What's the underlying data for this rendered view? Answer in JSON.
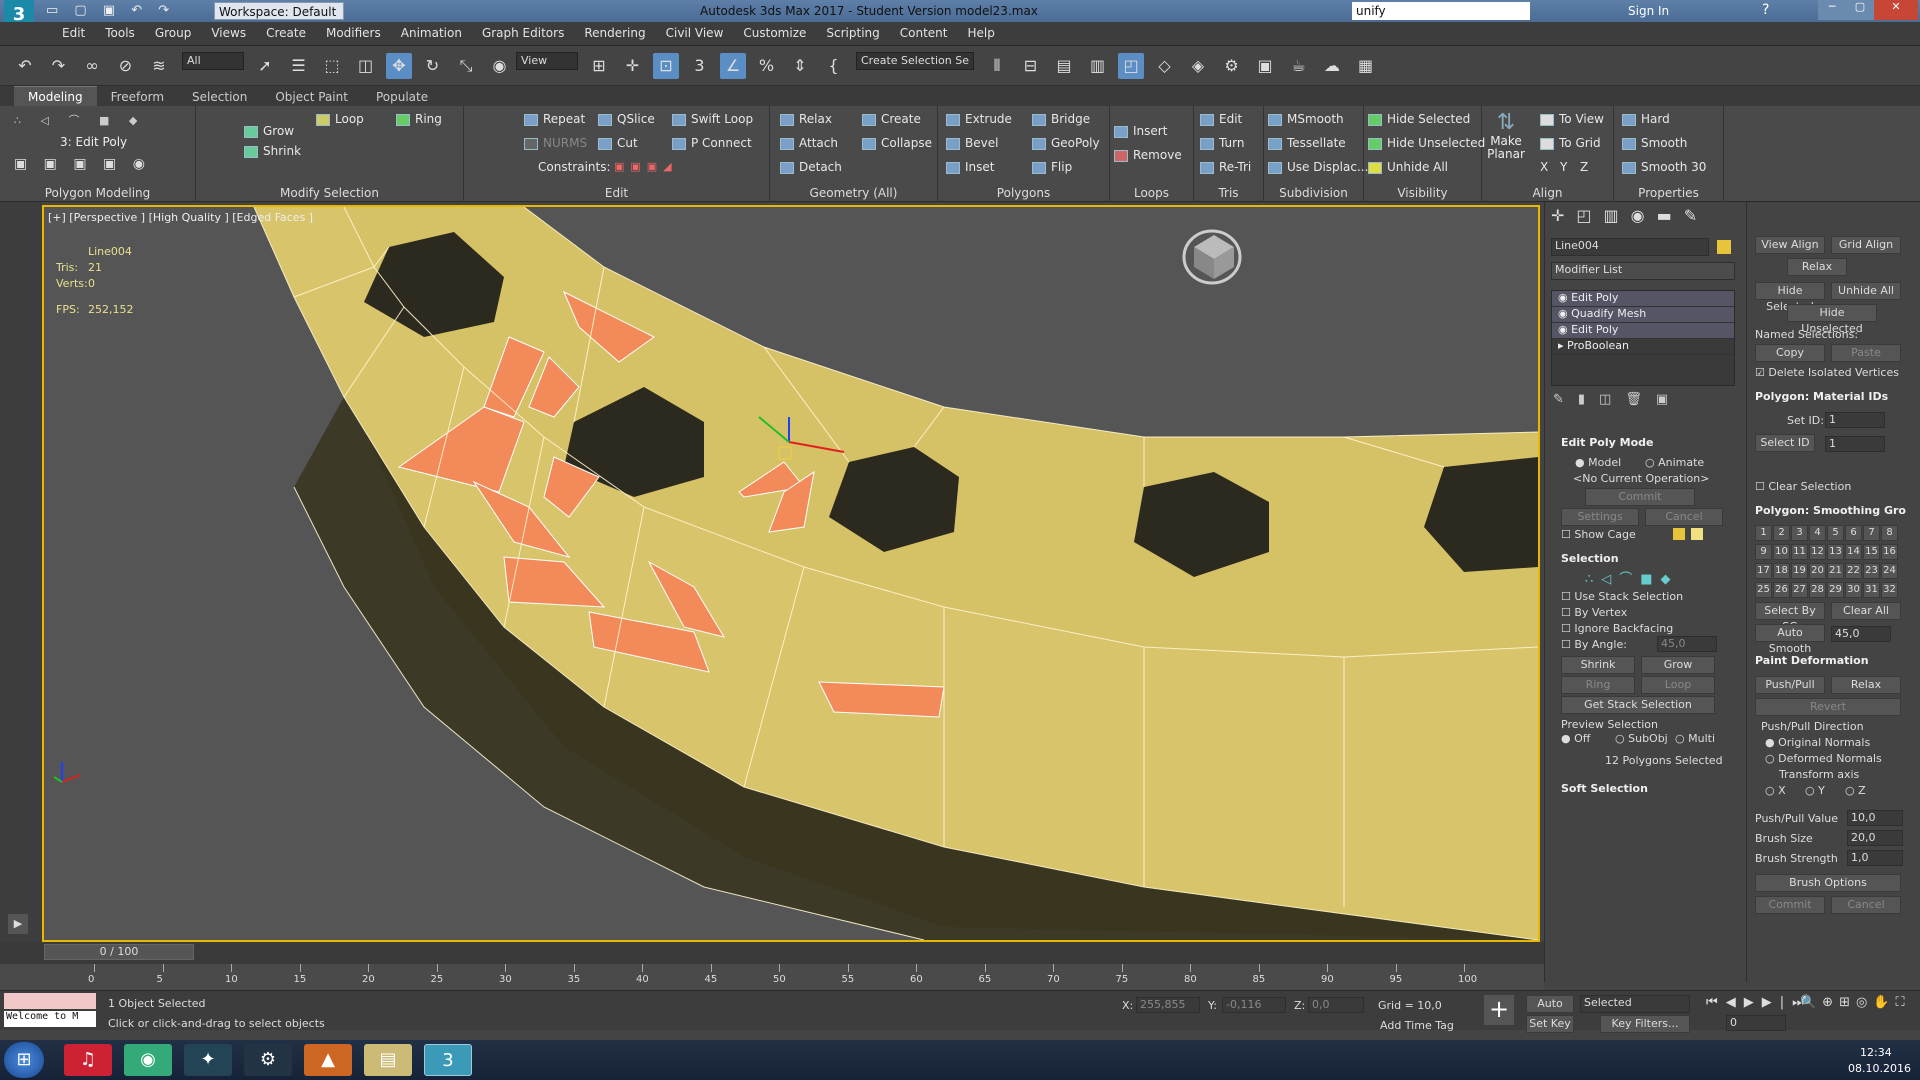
{
  "titlebar": {
    "app_icon": "3",
    "workspace": "Workspace: Default",
    "title": "Autodesk 3ds Max 2017 - Student Version    model23.max",
    "search_value": "unify",
    "sign_in": "Sign In"
  },
  "menu": [
    "Edit",
    "Tools",
    "Group",
    "Views",
    "Create",
    "Modifiers",
    "Animation",
    "Graph Editors",
    "Rendering",
    "Civil View",
    "Customize",
    "Scripting",
    "Content",
    "Help"
  ],
  "toolbar": {
    "filter": "All",
    "view": "View",
    "selection_set": "Create Selection Se"
  },
  "ribbon_tabs": [
    "Modeling",
    "Freeform",
    "Selection",
    "Object Paint",
    "Populate"
  ],
  "ribbon": {
    "polygon_modeling": {
      "label": "Polygon Modeling",
      "stack": "3: Edit Poly"
    },
    "modify_selection": {
      "label": "Modify Selection",
      "grow": "Grow",
      "shrink": "Shrink",
      "loop": "Loop",
      "ring": "Ring"
    },
    "edit": {
      "label": "Edit",
      "repeat": "Repeat",
      "qslice": "QSlice",
      "swift_loop": "Swift Loop",
      "nurms": "NURMS",
      "cut": "Cut",
      "p_connect": "P Connect",
      "constraints": "Constraints:"
    },
    "geometry": {
      "label": "Geometry (All)",
      "relax": "Relax",
      "create": "Create",
      "attach": "Attach",
      "collapse": "Collapse",
      "detach": "Detach"
    },
    "polygons": {
      "label": "Polygons",
      "extrude": "Extrude",
      "bridge": "Bridge",
      "bevel": "Bevel",
      "geopoly": "GeoPoly",
      "inset": "Inset",
      "flip": "Flip"
    },
    "loops": {
      "label": "Loops",
      "insert": "Insert",
      "remove": "Remove"
    },
    "tris": {
      "label": "Tris",
      "edit": "Edit",
      "turn": "Turn",
      "re_tri": "Re-Tri"
    },
    "subdivision": {
      "label": "Subdivision",
      "msmooth": "MSmooth",
      "tessellate": "Tessellate",
      "use_displac": "Use Displac..."
    },
    "visibility": {
      "label": "Visibility",
      "hide_selected": "Hide Selected",
      "hide_unselected": "Hide Unselected",
      "unhide_all": "Unhide All"
    },
    "align": {
      "label": "Align",
      "make_planar": "Make Planar",
      "to_view": "To View",
      "to_grid": "To Grid",
      "x": "X",
      "y": "Y",
      "z": "Z"
    },
    "properties": {
      "label": "Properties",
      "hard": "Hard",
      "smooth": "Smooth",
      "smooth30": "Smooth 30"
    }
  },
  "viewport": {
    "label": "[+] [Perspective ] [High Quality ] [Edged Faces ]",
    "stats_name": "Line004",
    "tris_label": "Tris:",
    "tris": "21",
    "verts_label": "Verts:",
    "verts": "0",
    "fps_label": "FPS:",
    "fps": "252,152",
    "base_color": "#d8c46a",
    "selected_color": "#f28a5a"
  },
  "cmdpanel": {
    "object_name": "Line004",
    "modifier_list": "Modifier List",
    "stack": [
      "Edit Poly",
      "Quadify Mesh",
      "Edit Poly",
      "ProBoolean"
    ],
    "edit_poly_mode": "Edit Poly Mode",
    "model": "Model",
    "animate": "Animate",
    "no_op": "<No Current Operation>",
    "commit": "Commit",
    "settings": "Settings",
    "cancel": "Cancel",
    "show_cage": "Show Cage",
    "selection": "Selection",
    "use_stack": "Use Stack Selection",
    "by_vertex": "By Vertex",
    "ignore_backfacing": "Ignore Backfacing",
    "by_angle": "By Angle:",
    "by_angle_val": "45,0",
    "shrink": "Shrink",
    "grow": "Grow",
    "ring": "Ring",
    "loop": "Loop",
    "get_stack": "Get Stack Selection",
    "preview_selection": "Preview Selection",
    "off": "Off",
    "subobj": "SubObj",
    "multi": "Multi",
    "selected_count": "12 Polygons Selected",
    "soft_selection": "Soft Selection"
  },
  "rollout": {
    "view_align": "View Align",
    "grid_align": "Grid Align",
    "relax": "Relax",
    "hide_selected": "Hide Selected",
    "unhide_all": "Unhide All",
    "hide_unselected": "Hide Unselected",
    "named_selections": "Named Selections:",
    "copy": "Copy",
    "paste": "Paste",
    "delete_isolated": "Delete Isolated Vertices",
    "mat_ids": "Polygon: Material IDs",
    "set_id": "Set ID:",
    "set_id_val": "1",
    "select_id": "Select ID",
    "select_id_val": "1",
    "clear_selection": "Clear Selection",
    "smoothing": "Polygon: Smoothing Gro",
    "sg": [
      "1",
      "2",
      "3",
      "4",
      "5",
      "6",
      "7",
      "8",
      "9",
      "10",
      "11",
      "12",
      "13",
      "14",
      "15",
      "16",
      "17",
      "18",
      "19",
      "20",
      "21",
      "22",
      "23",
      "24",
      "25",
      "26",
      "27",
      "28",
      "29",
      "30",
      "31",
      "32"
    ],
    "select_by_sg": "Select By SG",
    "clear_all": "Clear All",
    "auto_smooth": "Auto Smooth",
    "auto_smooth_val": "45,0",
    "paint_deformation": "Paint Deformation",
    "push_pull": "Push/Pull",
    "relax2": "Relax",
    "revert": "Revert",
    "push_pull_dir": "Push/Pull Direction",
    "original_normals": "Original Normals",
    "deformed_normals": "Deformed Normals",
    "transform_axis": "Transform axis",
    "x": "X",
    "y": "Y",
    "z": "Z",
    "push_pull_value": "Push/Pull Value",
    "push_pull_value_val": "10,0",
    "brush_size": "Brush Size",
    "brush_size_val": "20,0",
    "brush_strength": "Brush Strength",
    "brush_strength_val": "1,0",
    "brush_options": "Brush Options",
    "commit": "Commit",
    "cancel": "Cancel"
  },
  "timeline": {
    "frame": "0 / 100",
    "ticks": [
      "0",
      "5",
      "10",
      "15",
      "20",
      "25",
      "30",
      "35",
      "40",
      "45",
      "50",
      "55",
      "60",
      "65",
      "70",
      "75",
      "80",
      "85",
      "90",
      "95",
      "100"
    ]
  },
  "status": {
    "welcome": "Welcome to M",
    "objects": "1 Object Selected",
    "prompt": "Click or click-and-drag to select objects",
    "x_label": "X:",
    "x": "255,855",
    "y_label": "Y:",
    "y": "-0,116",
    "z_label": "Z:",
    "z": "0,0",
    "grid": "Grid = 10,0",
    "add_time_tag": "Add Time Tag",
    "auto_key": "Auto Key",
    "set_key": "Set Key",
    "selected": "Selected",
    "key_filters": "Key Filters...",
    "frame_val": "0"
  },
  "taskbar": {
    "time": "12:34",
    "date": "08.10.2016"
  }
}
